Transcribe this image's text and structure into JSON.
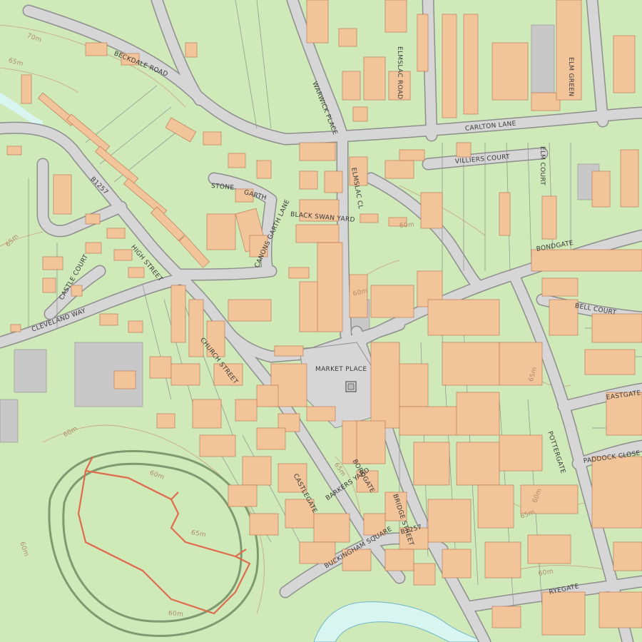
{
  "colors": {
    "land": "#cfe9b9",
    "road": "#d6d6d6",
    "road_edge": "#8e8e8e",
    "building": "#f2c49a",
    "building_edge": "#c07a55",
    "grey_area": "#c8c8c8",
    "water": "#d9f5f0",
    "contour": "#c9a27f",
    "castle": "#e06a4a"
  },
  "labels": {
    "beckdale_road": "BECKDALE ROAD",
    "warwick_place": "WARWICK PLACE",
    "elmslac_road": "ELMSLAC ROAD",
    "elm_green": "ELM GREEN",
    "carlton_lane": "CARLTON LANE",
    "elmslac_close": "ELMSLAC CL",
    "villiers_court": "VILLIERS COURT",
    "elm_court": "ELM COURT",
    "stone_garth": "STONE",
    "stone_garth2": "GARTH",
    "black_swan_yard": "BLACK SWAN YARD",
    "canons_garth_lane": "CANONS GARTH LANE",
    "bondgate": "BONDGATE",
    "bell_court": "BELL COURT",
    "high_street": "HIGH STREET",
    "castle_court": "CASTLE COURT",
    "cleveland_way": "CLEVELAND WAY",
    "church_street": "CHURCH STREET",
    "market_place": "MARKET PLACE",
    "eastgate": "EASTGATE",
    "pottergate": "POTTERGATE",
    "paddock_close": "PADDOCK CLOSE",
    "castlegate": "CASTLEGATE",
    "boroughgate": "BOROGATE",
    "barkers_yard": "BARKERS YARD",
    "bridge_street": "BRIDGE STREET",
    "buckingham_square": "BUCKINGHAM SQUARE",
    "b1257_a": "B1257",
    "b1257_b": "B1257",
    "ryegate": "RYEGATE"
  },
  "contours": {
    "c1": "70m",
    "c2": "65m",
    "c3": "65m",
    "c4": "60m",
    "c5": "60m",
    "c6": "60m",
    "c7": "65m",
    "c8": "60m",
    "c9": "65m",
    "c10": "65m",
    "c11": "65m",
    "c12": "60m",
    "c13": "60m",
    "c14": "60m",
    "c15": "60m"
  }
}
